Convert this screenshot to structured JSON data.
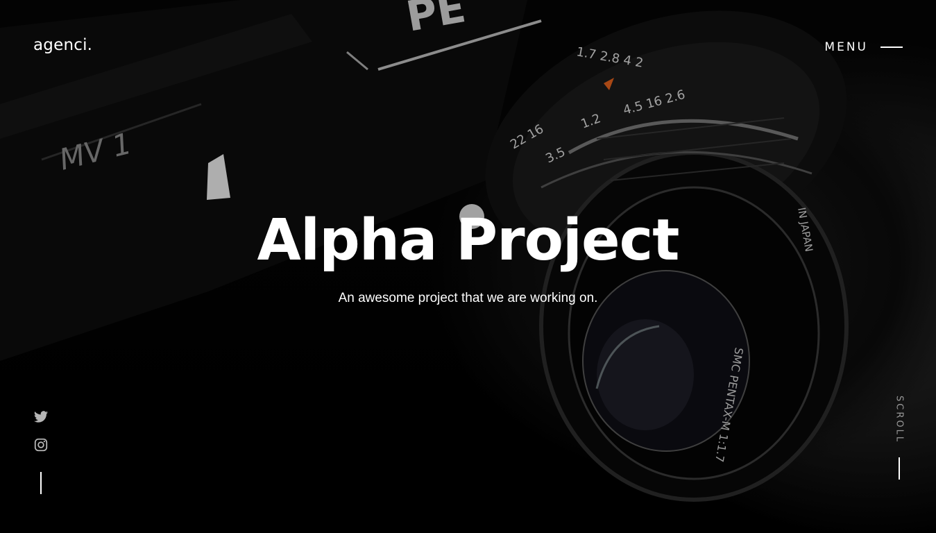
{
  "header": {
    "logo": "agenci.",
    "menu_label": "MENU"
  },
  "hero": {
    "title": "Alpha Project",
    "subtitle": "An awesome project that we are working on."
  },
  "social": {
    "icons": [
      "twitter-icon",
      "instagram-icon"
    ]
  },
  "scroll": {
    "label": "SCROLL"
  },
  "colors": {
    "text": "#ffffff",
    "muted": "#9a9a9a",
    "background": "#000000"
  }
}
